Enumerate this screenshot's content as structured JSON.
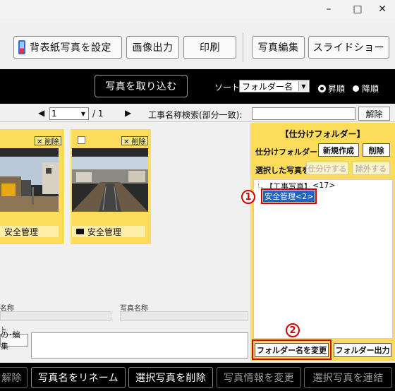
{
  "window_controls": {
    "minimize": "–",
    "maximize": "□",
    "close": "✕"
  },
  "toolbar": {
    "set_cover_label": "背表紙写真を設定",
    "image_output_label": "画像出力",
    "print_label": "印刷",
    "photo_edit_label": "写真編集",
    "slideshow_label": "スライドショー"
  },
  "import_bar": {
    "import_label": "写真を取り込む",
    "sort_label": "ソート",
    "sort_value": "フォルダー名",
    "asc_label": "昇順",
    "desc_label": "降順",
    "sort_order": "asc"
  },
  "pager": {
    "current_page": "1",
    "total_pages": "/ 1",
    "search_label": "工事名称検索(部分一致):",
    "search_value": "",
    "clear_label": "解除"
  },
  "cards": [
    {
      "delete_label": "✕ 削除",
      "folder_label": "安全管理"
    },
    {
      "delete_label": "✕ 削除",
      "folder_label": "安全管理"
    }
  ],
  "details": {
    "name_label_1": "名称",
    "photo_name_label": "写真名称",
    "comment_label": "ト",
    "edit_button_label": "の･編集"
  },
  "right_panel": {
    "title": "【仕分けフォルダー】",
    "sort_folder_label": "仕分けフォルダー",
    "new_button": "新規作成",
    "delete_button": "削除",
    "selected_photos_label": "選択した写真を",
    "sort_button": "仕分けする",
    "exclude_button": "除外する",
    "tree_root_label": "【工事写真】",
    "tree_root_count": "<17>",
    "tree_child_label": "安全管理<2>",
    "rename_folder_button": "フォルダー名を変更",
    "folder_output_button": "フォルダー出力"
  },
  "callouts": {
    "one": "1",
    "two": "2"
  },
  "bottom_bar": {
    "release_label": "解除",
    "rename_photo_label": "写真名をリネーム",
    "delete_selected_label": "選択写真を削除",
    "change_info_label": "写真情報を変更",
    "link_selected_label": "選択写真を連結"
  },
  "colors": {
    "accent_yellow": "#fddc5c",
    "highlight_red": "#d40000",
    "selection_blue": "#1e63c8"
  }
}
